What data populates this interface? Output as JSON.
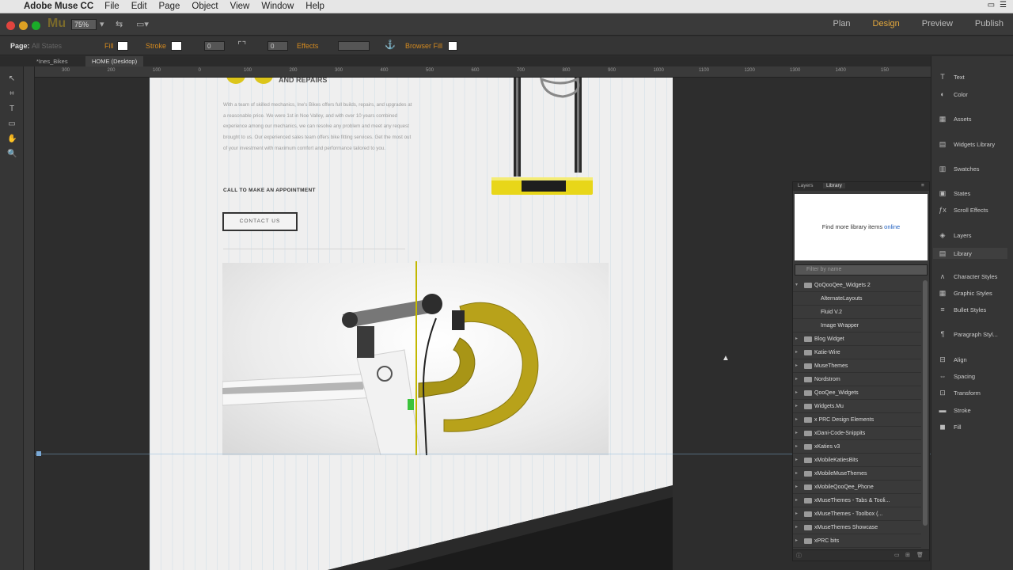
{
  "menubar": {
    "app_name": "Adobe Muse CC",
    "items": [
      "File",
      "Edit",
      "Page",
      "Object",
      "View",
      "Window",
      "Help"
    ]
  },
  "titlebar": {
    "logo": "Mu",
    "zoom": "75%",
    "modes": [
      "Plan",
      "Design",
      "Preview",
      "Publish"
    ],
    "active_mode": "Design"
  },
  "options_bar": {
    "page_label": "Page:",
    "page_value": "All States",
    "fill_label": "Fill",
    "stroke_label": "Stroke",
    "stroke_value": "0",
    "corner_value": "0",
    "effects_label": "Effects",
    "browser_fill_label": "Browser Fill"
  },
  "tabs": [
    "*Ines_Bikes",
    "HOME (Desktop)"
  ],
  "ruler_numbers": [
    "300",
    "200",
    "100",
    "0",
    "100",
    "200",
    "300",
    "400",
    "500",
    "600",
    "700",
    "800",
    "900",
    "1000",
    "1100",
    "1200",
    "1300",
    "1400",
    "150"
  ],
  "canvas": {
    "heading": "AND REPAIRS",
    "paragraph": "With a team of skilled mechanics, Ine's Bikes offers full builds, repairs, and upgrades at a reasonable price. We were 1st in Noe Valley, and with over 10 years combined experience among our mechanics, we can resolve any problem and meet any request brought to us. Our experienced sales team offers bike fitting services. Get the most out of your investment with maximum comfort and performance tailored to you.",
    "call_text": "CALL TO MAKE AN APPOINTMENT",
    "contact_button": "CONTACT US"
  },
  "right_panel": {
    "items": [
      "Text",
      "Color",
      "Assets",
      "Widgets Library",
      "Swatches",
      "States",
      "Scroll Effects",
      "Layers",
      "Library",
      "Character Styles",
      "Graphic Styles",
      "Bullet Styles",
      "Paragraph Styl...",
      "Align",
      "Spacing",
      "Transform",
      "Stroke",
      "Fill"
    ],
    "selected": "Library"
  },
  "library_panel": {
    "tabs": [
      "Layers",
      "Library"
    ],
    "active_tab": "Library",
    "promo_text": "Find more library items",
    "promo_link": "online",
    "filter_placeholder": "Filter by name",
    "tree": [
      {
        "label": "QoQooQee_Widgets 2",
        "level": 0,
        "expanded": true
      },
      {
        "label": "AlternateLayouts",
        "level": 1
      },
      {
        "label": "Fluid V.2",
        "level": 1
      },
      {
        "label": "Image Wrapper",
        "level": 1
      },
      {
        "label": "Blog Widget",
        "level": 0
      },
      {
        "label": "Katie-Wire",
        "level": 0
      },
      {
        "label": "MuseThemes",
        "level": 0
      },
      {
        "label": "Nordstrom",
        "level": 0
      },
      {
        "label": "QooQee_Widgets",
        "level": 0
      },
      {
        "label": "Widgets.Mu",
        "level": 0
      },
      {
        "label": "x PRC Design Elements",
        "level": 0
      },
      {
        "label": "xDani-Code-Snippits",
        "level": 0
      },
      {
        "label": "xKaties v3",
        "level": 0
      },
      {
        "label": "xMobileKatiesBits",
        "level": 0
      },
      {
        "label": "xMobileMuseThemes",
        "level": 0
      },
      {
        "label": "xMobileQooQee_Phone",
        "level": 0
      },
      {
        "label": "xMuseThemes - Tabs & Tooli...",
        "level": 0
      },
      {
        "label": "xMuseThemes - Toolbox (...",
        "level": 0
      },
      {
        "label": "xMuseThemes Showcase",
        "level": 0
      },
      {
        "label": "xPRC bits",
        "level": 0
      }
    ]
  },
  "colors": {
    "accent_orange": "#e5a93d",
    "bike_yellow": "#b8a21a",
    "guide_yellow": "#c2b800",
    "panel_bg": "#353535"
  }
}
